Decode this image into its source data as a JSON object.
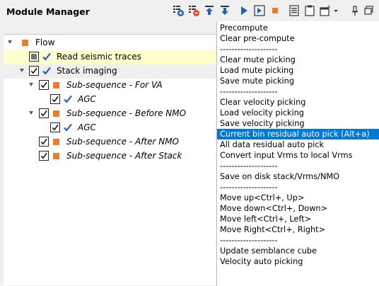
{
  "header": {
    "title": "Module Manager"
  },
  "toolbar": {
    "buttons": [
      {
        "name": "add-module-icon"
      },
      {
        "name": "remove-module-icon"
      },
      {
        "name": "move-up-icon"
      },
      {
        "name": "move-down-icon"
      },
      {
        "name": "run-icon"
      },
      {
        "name": "run-step-icon"
      },
      {
        "name": "stop-icon"
      },
      {
        "name": "list-icon"
      },
      {
        "name": "clipboard-icon"
      },
      {
        "name": "new-window-icon"
      },
      {
        "name": "dropdown-icon"
      },
      {
        "name": "pin-icon"
      },
      {
        "name": "float-icon"
      }
    ],
    "colors": {
      "blue": "#1f5fbf",
      "orange": "#f07b27",
      "red": "#e54b2a",
      "green": "#3a9a3a"
    }
  },
  "tree": {
    "items": [
      {
        "label": "Flow",
        "level": 0,
        "expanded": true,
        "checkbox": "none",
        "icon": "orange-square",
        "italic": false,
        "state": "normal"
      },
      {
        "label": "Read seismic traces",
        "level": 1,
        "expanded": false,
        "checkbox": "partial",
        "icon": "blue-check",
        "italic": false,
        "state": "selected"
      },
      {
        "label": "Stack imaging",
        "level": 1,
        "expanded": true,
        "checkbox": "checked",
        "icon": "blue-check",
        "italic": false,
        "state": "hover"
      },
      {
        "label": "Sub-sequence - For VA",
        "level": 2,
        "expanded": true,
        "checkbox": "checked",
        "icon": "orange-square",
        "italic": true,
        "state": "normal"
      },
      {
        "label": "AGC",
        "level": 3,
        "expanded": false,
        "checkbox": "checked",
        "icon": "blue-check",
        "italic": true,
        "state": "normal"
      },
      {
        "label": "Sub-sequence - Before NMO",
        "level": 2,
        "expanded": true,
        "checkbox": "checked",
        "icon": "orange-square",
        "italic": true,
        "state": "normal"
      },
      {
        "label": "AGC",
        "level": 3,
        "expanded": false,
        "checkbox": "checked",
        "icon": "blue-check",
        "italic": true,
        "state": "normal"
      },
      {
        "label": "Sub-sequence - After NMO",
        "level": 2,
        "expanded": false,
        "checkbox": "checked",
        "icon": "orange-square",
        "italic": true,
        "state": "normal"
      },
      {
        "label": "Sub-sequence - After Stack",
        "level": 2,
        "expanded": false,
        "checkbox": "checked",
        "icon": "orange-square",
        "italic": true,
        "state": "normal"
      }
    ]
  },
  "menu": {
    "items": [
      {
        "label": "Precompute"
      },
      {
        "label": "Clear pre-compute"
      },
      {
        "label": "--------------------"
      },
      {
        "label": "Clear mute picking"
      },
      {
        "label": "Load mute picking"
      },
      {
        "label": "Save mute picking"
      },
      {
        "label": "--------------------"
      },
      {
        "label": "Clear velocity picking"
      },
      {
        "label": "Load velocity picking"
      },
      {
        "label": "Save velocity picking"
      },
      {
        "label": "Current bin residual auto pick (Alt+a)",
        "selected": true
      },
      {
        "label": "All data residual auto pick"
      },
      {
        "label": "Convert input Vrms to local Vrms"
      },
      {
        "label": "--------------------"
      },
      {
        "label": "Save on disk stack/Vrms/NMO"
      },
      {
        "label": "--------------------"
      },
      {
        "label": "Move up<Ctrl+, Up>"
      },
      {
        "label": "Move down<Ctrl+, Down>"
      },
      {
        "label": "Move left<Ctrl+, Left>"
      },
      {
        "label": "Move Right<Ctrl+, Right>"
      },
      {
        "label": "--------------------"
      },
      {
        "label": "Update semblance cube"
      },
      {
        "label": "Velocity auto picking"
      }
    ]
  }
}
